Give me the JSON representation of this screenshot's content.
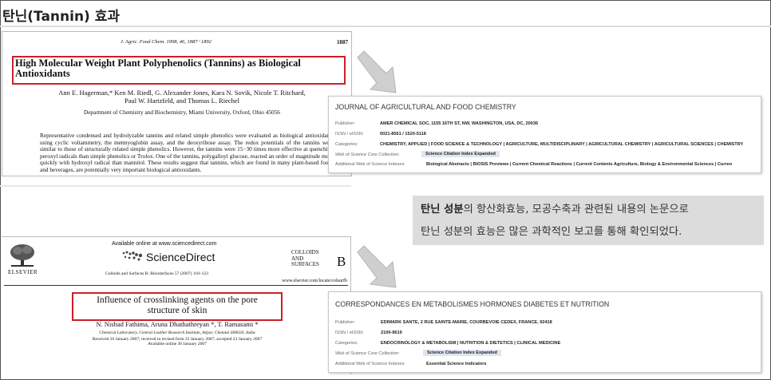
{
  "slide_title": "탄닌(Tannin) 효과",
  "paper1": {
    "journal": "J. Agric. Food Chem. 1998, 46, 1887−1892",
    "page_number": "1887",
    "title_line1": "High Molecular Weight Plant Polyphenolics (Tannins) as Biological",
    "title_line2": "Antioxidants",
    "authors_line1": "Ann E. Hagerman,* Ken M. Riedl, G. Alexander Jones, Kara N. Sovik, Nicole T. Ritchard,",
    "authors_line2": "Paul W. Hartzfeld, and Thomas L. Riechel",
    "affiliation": "Department of Chemistry and Biochemistry, Miami University, Oxford, Ohio 45056",
    "abstract": "Representative condensed and hydrolyzable tannins and related simple phenolics were evaluated as biological antioxidants using cyclic voltammetry, the metmyoglobin assay, and the deoxyribose assay. The redox potentials of the tannins were similar to those of structurally related simple phenolics. However, the tannins were 15−30 times more effective at quenching peroxyl radicals than simple phenolics or Trolox. One of the tannins, polygalloyl glucose, reacted an order of magnitude more quickly with hydroxyl radical than mannitol. These results suggest that tannins, which are found in many plant-based foods and beverages, are potentially very important biological antioxidants."
  },
  "paper2": {
    "available_online": "Available online at www.sciencedirect.com",
    "publisher_brand": "ScienceDirect",
    "citation": "Colloids and Surfaces B: Biointerfaces  57 (2007) 118–123",
    "publisher_logo_text": "ELSEVIER",
    "journal_mark_line1": "COLLOIDS",
    "journal_mark_line2": "AND",
    "journal_mark_line3": "SURFACES",
    "journal_mark_letter": "B",
    "url": "www.elsevier.com/locate/colsurfb",
    "title_line1": "Influence of crosslinking agents on the pore",
    "title_line2": "structure of skin",
    "authors": "N. Nishad Fathima, Aruna Dhathathreyan *, T. Ramasami *",
    "affiliation": "Chemical Laboratory, Central Leather Research Institute, Adyar, Chennai 600020, India",
    "received": "Received 10 January 2007; received in revised form 22 January 2007; accepted 23 January 2007",
    "online": "Available online 30 January 2007"
  },
  "card1": {
    "title": "JOURNAL OF AGRICULTURAL AND FOOD CHEMISTRY",
    "rows": [
      {
        "label": "Publisher:",
        "value": "AMER CHEMICAL SOC, 1155 16TH ST, NW, WASHINGTON, USA, DC, 20036"
      },
      {
        "label": "ISSN / eISSN:",
        "value": "0021-8561 / 1520-5118"
      },
      {
        "label": "Categories:",
        "value": "CHEMISTRY, APPLIED | FOOD SCIENCE & TECHNOLOGY | AGRICULTURE, MULTIDISCIPLINARY | AGRICULTURAL CHEMISTRY | AGRICULTURAL SCIENCES | CHEMISTRY"
      },
      {
        "label": "Web of Science Core Collection:",
        "value": "Science Citation Index Expanded"
      },
      {
        "label": "Additional Web of Science Indexes:",
        "value": "Biological Abstracts | BIOSIS Previews | Current Chemical Reactions | Current Contents Agriculture, Biology & Environmental Sciences | Curren"
      }
    ]
  },
  "card2": {
    "title": "CORRESPONDANCES EN METABOLISMES HORMONES DIABETES ET NUTRITION",
    "rows": [
      {
        "label": "Publisher:",
        "value": "EDIMARK SANTE, 2 RUE SAINTE-MARIE, COURBEVOIE CEDEX, FRANCE, 92418"
      },
      {
        "label": "ISSN / eISSN:",
        "value": "2100-9619"
      },
      {
        "label": "Categories:",
        "value": "ENDOCRINOLOGY & METABOLISM | NUTRITION & DIETETICS | CLINICAL MEDICINE"
      },
      {
        "label": "Web of Science Core Collection:",
        "value": "Science Citation Index Expanded"
      },
      {
        "label": "Additional Web of Science Indexes:",
        "value": "Essential Science Indicators"
      }
    ]
  },
  "note": {
    "line1_bold": "탄닌 성분",
    "line1_rest": "의 항산화효능, 모공수축과 관련된 내용의 논문으로",
    "line2": "탄닌 성분의 효능은 많은 과학적인 보고를 통해 확인되었다."
  },
  "colors": {
    "highlight_box": "#c8202a",
    "note_background": "#dcdcdc",
    "index_highlight": "#dfe6f1",
    "arrow": "#cfcfcf"
  }
}
